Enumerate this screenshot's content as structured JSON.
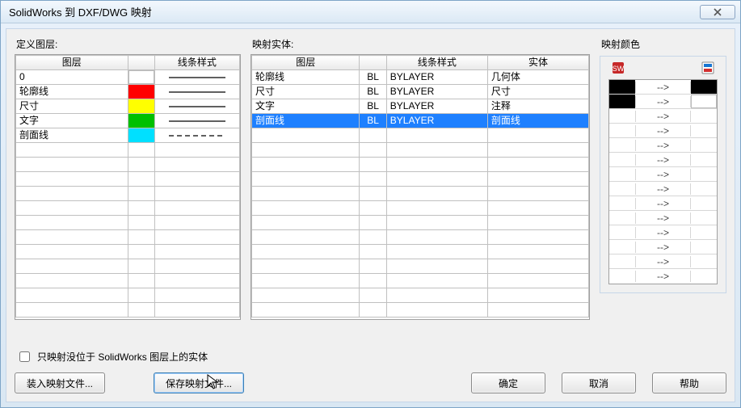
{
  "window": {
    "title": "SolidWorks 到 DXF/DWG 映射"
  },
  "sections": {
    "define_layers": "定义图层:",
    "map_entities": "映射实体:",
    "map_colors": "映射颜色"
  },
  "layers_table": {
    "headers": {
      "layer": "图层",
      "color": "",
      "line_style": "线条样式"
    },
    "rows": [
      {
        "name": "0",
        "color": "#ffffff",
        "dashed": false
      },
      {
        "name": "轮廓线",
        "color": "#ff0000",
        "dashed": false
      },
      {
        "name": "尺寸",
        "color": "#ffff00",
        "dashed": false
      },
      {
        "name": "文字",
        "color": "#00c000",
        "dashed": false
      },
      {
        "name": "剖面线",
        "color": "#00e0ff",
        "dashed": true
      }
    ],
    "empty_rows": 12
  },
  "entities_table": {
    "headers": {
      "layer": "图层",
      "short": "",
      "line_style": "线条样式",
      "entity": "实体"
    },
    "rows": [
      {
        "layer": "轮廓线",
        "short": "BL",
        "line_style": "BYLAYER",
        "entity": "几何体",
        "selected": false
      },
      {
        "layer": "尺寸",
        "short": "BL",
        "line_style": "BYLAYER",
        "entity": "尺寸",
        "selected": false
      },
      {
        "layer": "文字",
        "short": "BL",
        "line_style": "BYLAYER",
        "entity": "注释",
        "selected": false
      },
      {
        "layer": "剖面线",
        "short": "BL",
        "line_style": "BYLAYER",
        "entity": "剖面线",
        "selected": true
      }
    ],
    "empty_rows": 13
  },
  "color_map": {
    "rows": [
      {
        "left": "#000000",
        "right": "#000000"
      },
      {
        "left": "#000000",
        "right": "#ffffff"
      },
      {
        "left": "",
        "right": ""
      },
      {
        "left": "",
        "right": ""
      },
      {
        "left": "",
        "right": ""
      },
      {
        "left": "",
        "right": ""
      },
      {
        "left": "",
        "right": ""
      },
      {
        "left": "",
        "right": ""
      },
      {
        "left": "",
        "right": ""
      },
      {
        "left": "",
        "right": ""
      },
      {
        "left": "",
        "right": ""
      },
      {
        "left": "",
        "right": ""
      },
      {
        "left": "",
        "right": ""
      },
      {
        "left": "",
        "right": ""
      }
    ],
    "arrow": "-->"
  },
  "checkbox": {
    "label": "只映射没位于 SolidWorks 图层上的实体",
    "checked": false
  },
  "buttons": {
    "load": "装入映射文件...",
    "save": "保存映射文件...",
    "ok": "确定",
    "cancel": "取消",
    "help": "帮助"
  }
}
